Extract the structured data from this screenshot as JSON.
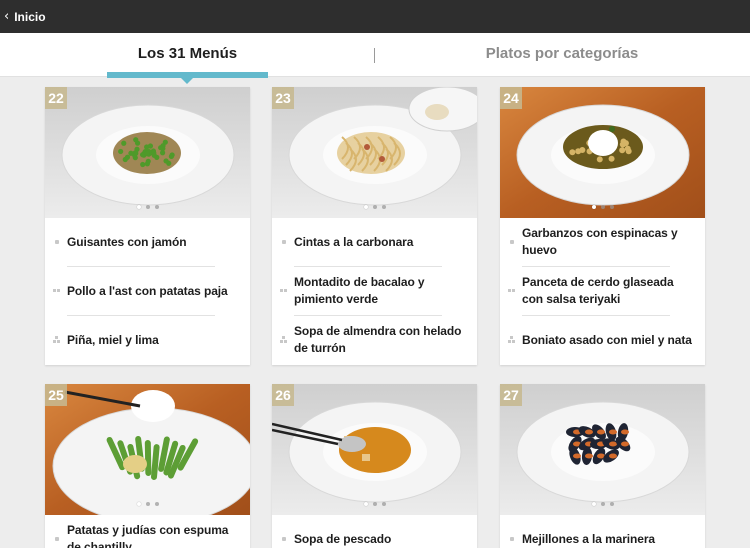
{
  "header": {
    "back_label": "Inicio"
  },
  "tabs": {
    "active": "Los 31 Menús",
    "inactive": "Platos por categorías"
  },
  "cards": [
    {
      "number": "22",
      "items": [
        "Guisantes con jamón",
        "Pollo a l'ast con patatas paja",
        "Piña, miel y lima"
      ],
      "dish": "peas",
      "bg": "#dcdcdc",
      "table": "light"
    },
    {
      "number": "23",
      "items": [
        "Cintas a la carbonara",
        "Montadito de bacalao y pimiento verde",
        "Sopa de almendra con helado de turrón"
      ],
      "dish": "pasta",
      "bg": "#e2e2e2",
      "table": "light"
    },
    {
      "number": "24",
      "items": [
        "Garbanzos con espinacas y huevo",
        "Panceta de cerdo glaseada con salsa teriyaki",
        "Boniato asado con miel y nata"
      ],
      "dish": "chickpeas",
      "bg": "#c9712f",
      "table": "wood"
    },
    {
      "number": "25",
      "items": [
        "Patatas y judías con espuma de chantilly"
      ],
      "dish": "beans",
      "bg": "#c9712f",
      "table": "wood"
    },
    {
      "number": "26",
      "items": [
        "Sopa de pescado"
      ],
      "dish": "soup",
      "bg": "#dcdcdc",
      "table": "light"
    },
    {
      "number": "27",
      "items": [
        "Mejillones a la marinera"
      ],
      "dish": "mussels",
      "bg": "#e4e4e4",
      "table": "light"
    }
  ]
}
